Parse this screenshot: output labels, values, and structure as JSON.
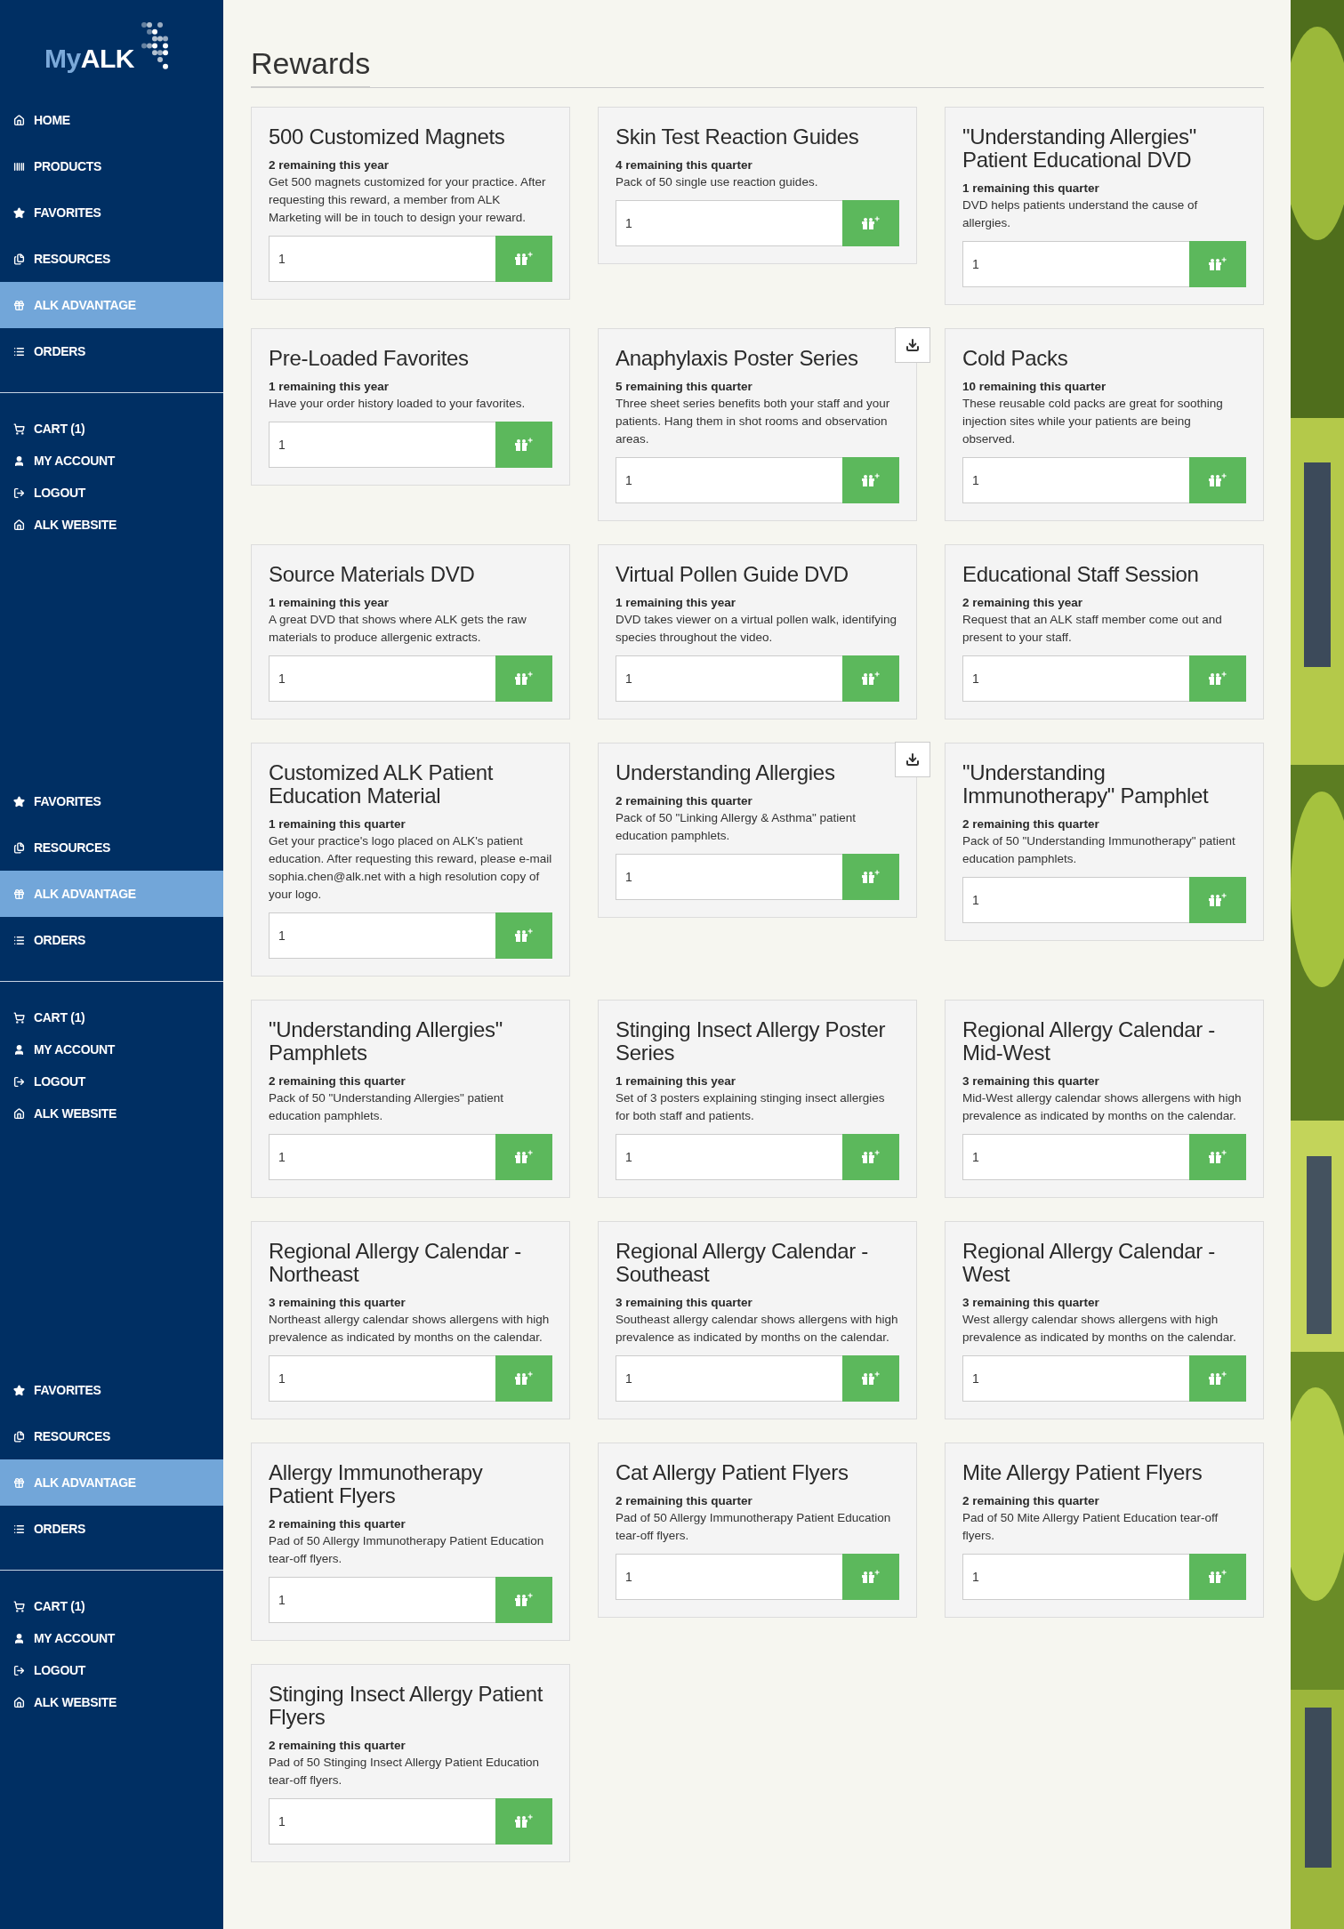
{
  "sidebar": {
    "logo": {
      "prefix": "My",
      "name": "ALK"
    },
    "sections": [
      {
        "nav": [
          {
            "label": "HOME",
            "kind": "home",
            "selected": false
          },
          {
            "label": "PRODUCTS",
            "kind": "products",
            "selected": false
          },
          {
            "label": "FAVORITES",
            "kind": "favorites",
            "selected": false
          },
          {
            "label": "RESOURCES",
            "kind": "resources",
            "selected": false
          },
          {
            "label": "ALK ADVANTAGE",
            "kind": "rewards",
            "selected": true
          },
          {
            "label": "ORDERS",
            "kind": "orders",
            "selected": false
          }
        ],
        "account": [
          {
            "label": "CART (1)",
            "kind": "cart"
          },
          {
            "label": "MY ACCOUNT",
            "kind": "account"
          },
          {
            "label": "LOGOUT",
            "kind": "logout"
          },
          {
            "label": "ALK WEBSITE",
            "kind": "home"
          }
        ]
      },
      {
        "nav": [
          {
            "label": "FAVORITES",
            "kind": "favorites",
            "selected": false
          },
          {
            "label": "RESOURCES",
            "kind": "resources",
            "selected": false
          },
          {
            "label": "ALK ADVANTAGE",
            "kind": "rewards",
            "selected": true
          },
          {
            "label": "ORDERS",
            "kind": "orders",
            "selected": false
          }
        ],
        "account": [
          {
            "label": "CART (1)",
            "kind": "cart"
          },
          {
            "label": "MY ACCOUNT",
            "kind": "account"
          },
          {
            "label": "LOGOUT",
            "kind": "logout"
          },
          {
            "label": "ALK WEBSITE",
            "kind": "home"
          }
        ]
      },
      {
        "nav": [
          {
            "label": "FAVORITES",
            "kind": "favorites",
            "selected": false
          },
          {
            "label": "RESOURCES",
            "kind": "resources",
            "selected": false
          },
          {
            "label": "ALK ADVANTAGE",
            "kind": "rewards",
            "selected": true
          },
          {
            "label": "ORDERS",
            "kind": "orders",
            "selected": false
          }
        ],
        "account": [
          {
            "label": "CART (1)",
            "kind": "cart"
          },
          {
            "label": "MY ACCOUNT",
            "kind": "account"
          },
          {
            "label": "LOGOUT",
            "kind": "logout"
          },
          {
            "label": "ALK WEBSITE",
            "kind": "home"
          }
        ]
      }
    ]
  },
  "page_title": "Rewards",
  "rewards": [
    {
      "title": "500 Customized Magnets",
      "remaining": "2 remaining this year",
      "description": "Get 500 magnets customized for your practice. After requesting this reward, a member from ALK Marketing will be in touch to design your reward.",
      "quantity": "1",
      "download": false
    },
    {
      "title": "Skin Test Reaction Guides",
      "remaining": "4 remaining this quarter",
      "description": "Pack of 50 single use reaction guides.",
      "quantity": "1",
      "download": false
    },
    {
      "title": "\"Understanding Allergies\" Patient Educational DVD",
      "remaining": "1 remaining this quarter",
      "description": "DVD helps patients understand the cause of allergies.",
      "quantity": "1",
      "download": false
    },
    {
      "title": "Pre-Loaded Favorites",
      "remaining": "1 remaining this year",
      "description": "Have your order history loaded to your favorites.",
      "quantity": "1",
      "download": false
    },
    {
      "title": "Anaphylaxis Poster Series",
      "remaining": "5 remaining this quarter",
      "description": "Three sheet series benefits both your staff and your patients. Hang them in shot rooms and observation areas.",
      "quantity": "1",
      "download": true
    },
    {
      "title": "Cold Packs",
      "remaining": "10 remaining this quarter",
      "description": "These reusable cold packs are great for soothing injection sites while your patients are being observed.",
      "quantity": "1",
      "download": false
    },
    {
      "title": "Source Materials DVD",
      "remaining": "1 remaining this year",
      "description": "A great DVD that shows where ALK gets the raw materials to produce allergenic extracts.",
      "quantity": "1",
      "download": false
    },
    {
      "title": "Virtual Pollen Guide DVD",
      "remaining": "1 remaining this year",
      "description": "DVD takes viewer on a virtual pollen walk, identifying species throughout the video.",
      "quantity": "1",
      "download": false
    },
    {
      "title": "Educational Staff Session",
      "remaining": "2 remaining this year",
      "description": "Request that an ALK staff member come out and present to your staff.",
      "quantity": "1",
      "download": false
    },
    {
      "title": "Customized ALK Patient Education Material",
      "remaining": "1 remaining this quarter",
      "description": "Get your practice's logo placed on ALK's patient education. After requesting this reward, please e-mail sophia.chen@alk.net with a high resolution copy of your logo.",
      "quantity": "1",
      "download": false
    },
    {
      "title": "Understanding Allergies",
      "remaining": "2 remaining this quarter",
      "description": "Pack of 50 \"Linking Allergy & Asthma\" patient education pamphlets.",
      "quantity": "1",
      "download": true
    },
    {
      "title": "\"Understanding Immunotherapy\" Pamphlet",
      "remaining": "2 remaining this quarter",
      "description": "Pack of 50 \"Understanding Immunotherapy\" patient education pamphlets.",
      "quantity": "1",
      "download": false
    },
    {
      "title": "\"Understanding Allergies\" Pamphlets",
      "remaining": "2 remaining this quarter",
      "description": "Pack of 50 \"Understanding Allergies\" patient education pamphlets.",
      "quantity": "1",
      "download": false
    },
    {
      "title": "Stinging Insect Allergy Poster Series",
      "remaining": "1 remaining this year",
      "description": "Set of 3 posters explaining stinging insect allergies for both staff and patients.",
      "quantity": "1",
      "download": false
    },
    {
      "title": "Regional Allergy Calendar - Mid-West",
      "remaining": "3 remaining this quarter",
      "description": "Mid-West allergy calendar shows allergens with high prevalence as indicated by months on the calendar.",
      "quantity": "1",
      "download": false
    },
    {
      "title": "Regional Allergy Calendar - Northeast",
      "remaining": "3 remaining this quarter",
      "description": "Northeast allergy calendar shows allergens with high prevalence as indicated by months on the calendar.",
      "quantity": "1",
      "download": false
    },
    {
      "title": "Regional Allergy Calendar - Southeast",
      "remaining": "3 remaining this quarter",
      "description": "Southeast allergy calendar shows allergens with high prevalence as indicated by months on the calendar.",
      "quantity": "1",
      "download": false
    },
    {
      "title": "Regional Allergy Calendar - West",
      "remaining": "3 remaining this quarter",
      "description": "West allergy calendar shows allergens with high prevalence as indicated by months on the calendar.",
      "quantity": "1",
      "download": false
    },
    {
      "title": "Allergy Immunotherapy Patient Flyers",
      "remaining": "2 remaining this quarter",
      "description": "Pad of 50 Allergy Immunotherapy Patient Education tear-off flyers.",
      "quantity": "1",
      "download": false
    },
    {
      "title": "Cat Allergy Patient Flyers",
      "remaining": "2 remaining this quarter",
      "description": "Pad of 50 Allergy Immunotherapy Patient Education tear-off flyers.",
      "quantity": "1",
      "download": false
    },
    {
      "title": "Mite Allergy Patient Flyers",
      "remaining": "2 remaining this quarter",
      "description": "Pad of 50 Mite Allergy Patient Education tear-off flyers.",
      "quantity": "1",
      "download": false
    },
    {
      "title": "Stinging Insect Allergy Patient Flyers",
      "remaining": "2 remaining this quarter",
      "description": "Pad of 50 Stinging Insect Allergy Patient Education tear-off flyers.",
      "quantity": "1",
      "download": false
    }
  ]
}
